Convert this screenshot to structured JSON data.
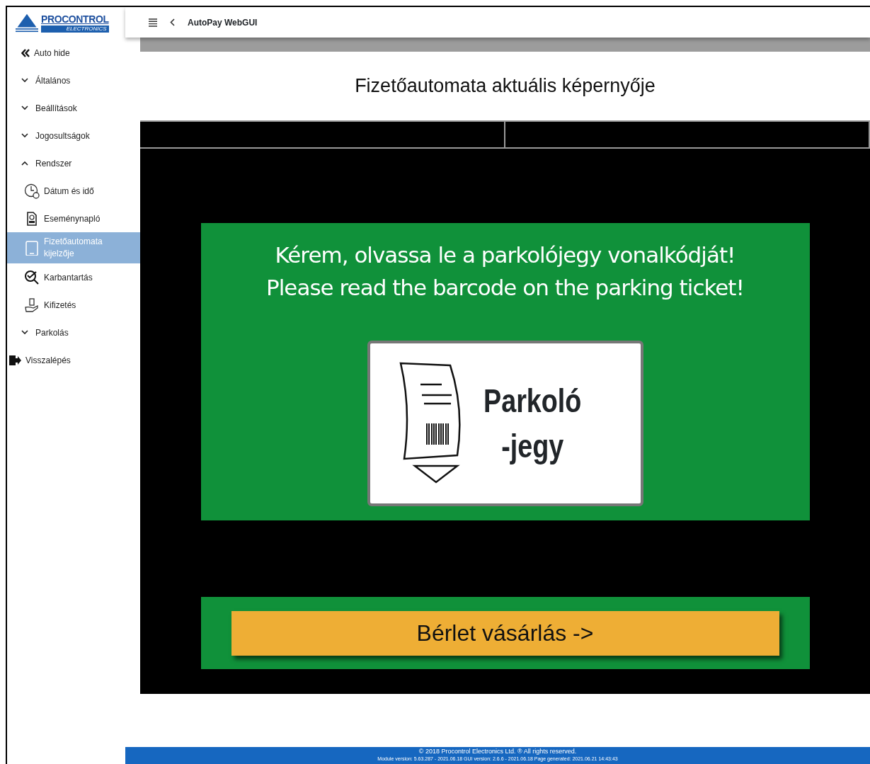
{
  "logo": {
    "name": "PROCONTROL",
    "subtitle": "ELECTRONICS"
  },
  "topbar": {
    "title": "AutoPay WebGUI"
  },
  "sidebar": {
    "items": [
      {
        "kind": "toggle",
        "label": "Auto hide"
      },
      {
        "kind": "group",
        "label": "Általános",
        "expanded": false
      },
      {
        "kind": "group",
        "label": "Beállítások",
        "expanded": false
      },
      {
        "kind": "group",
        "label": "Jogosultságok",
        "expanded": false
      },
      {
        "kind": "group",
        "label": "Rendszer",
        "expanded": true,
        "children": [
          {
            "label": "Dátum és idő",
            "selected": false
          },
          {
            "label": "Eseménynapló",
            "selected": false
          },
          {
            "label": "Fizetőautomata kijelzője",
            "selected": true
          },
          {
            "label": "Karbantartás",
            "selected": false
          },
          {
            "label": "Kifizetés",
            "selected": false
          }
        ]
      },
      {
        "kind": "group",
        "label": "Parkolás",
        "expanded": false
      },
      {
        "kind": "exit",
        "label": "Visszalépés"
      }
    ]
  },
  "page": {
    "title": "Fizetőautomata aktuális képernyője"
  },
  "kiosk": {
    "message_lines": [
      "Kérem, olvassa le a parkolójegy vonalkódját!",
      "Please read the barcode on the parking ticket!"
    ],
    "ticket_label_lines": [
      "Parkoló",
      "-jegy"
    ],
    "button": "Bérlet vásárlás ->"
  },
  "footer": {
    "copyright": "© 2018 Procontrol Electronics Ltd. ® All rights reserved.",
    "versions": "Module version: 5.63.287 - 2021.06.18     GUI version: 2.6.6 - 2021.06.18     Page generated: 2021.06.21 14:43:43"
  }
}
